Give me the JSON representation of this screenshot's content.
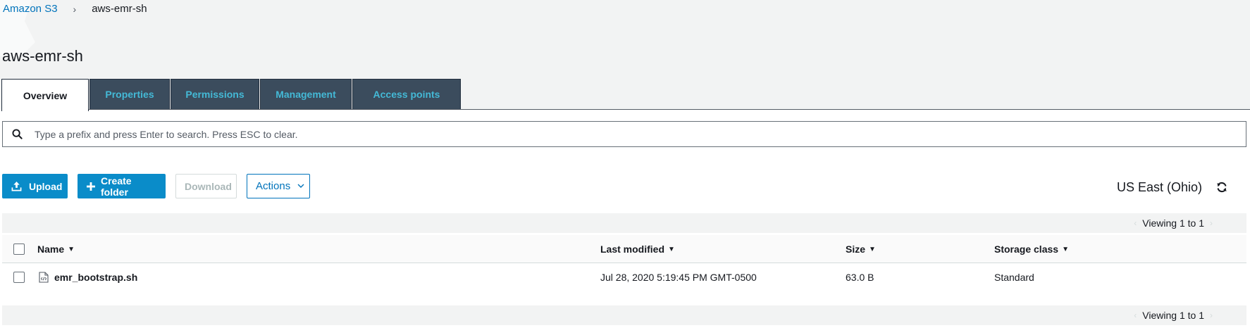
{
  "breadcrumb": {
    "root": "Amazon S3",
    "separator": "›",
    "current": "aws-emr-sh"
  },
  "page": {
    "title": "aws-emr-sh"
  },
  "tabs": [
    {
      "label": "Overview",
      "active": true
    },
    {
      "label": "Properties",
      "active": false
    },
    {
      "label": "Permissions",
      "active": false
    },
    {
      "label": "Management",
      "active": false
    },
    {
      "label": "Access points",
      "active": false
    }
  ],
  "search": {
    "placeholder": "Type a prefix and press Enter to search. Press ESC to clear.",
    "value": "",
    "icon": "search-icon"
  },
  "toolbar": {
    "upload_label": "Upload",
    "create_folder_label": "Create folder",
    "download_label": "Download",
    "actions_label": "Actions",
    "region": "US East (Ohio)",
    "refresh_icon": "refresh-icon"
  },
  "pagination": {
    "top_text": "Viewing 1 to 1",
    "bottom_text": "Viewing 1 to 1",
    "prev": "‹",
    "next": "›"
  },
  "table": {
    "columns": [
      "Name",
      "Last modified",
      "Size",
      "Storage class"
    ],
    "rows": [
      {
        "name": "emr_bootstrap.sh",
        "last_modified": "Jul 28, 2020 5:19:45 PM GMT-0500",
        "size": "63.0 B",
        "storage_class": "Standard",
        "icon": "file-code-icon"
      }
    ]
  },
  "colors": {
    "link": "#0073bb",
    "primary_button": "#0a8cc9",
    "tab_inactive_bg": "#3b4c5d",
    "tab_inactive_text": "#44b9d6",
    "band_bg": "#f2f3f3"
  }
}
